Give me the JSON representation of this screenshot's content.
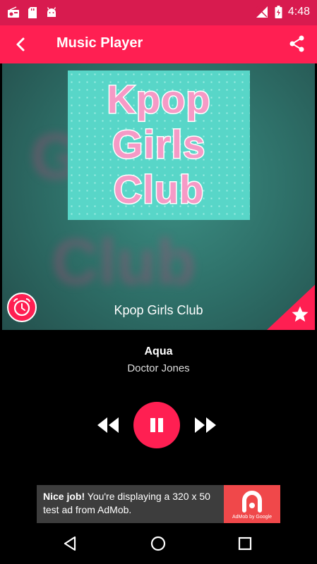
{
  "status_bar": {
    "time": "4:48",
    "icons": [
      "radio-icon",
      "sd-card-icon",
      "android-icon",
      "signal-icon",
      "battery-icon"
    ]
  },
  "app_bar": {
    "title": "Music Player",
    "back_icon": "back-arrow-icon",
    "share_icon": "share-icon"
  },
  "station": {
    "artwork_lines": [
      "Kpop",
      "Girls",
      "Club"
    ],
    "name": "Kpop Girls Club"
  },
  "now_playing": {
    "song": "Aqua",
    "artist": "Doctor Jones"
  },
  "ad": {
    "headline": "Nice job!",
    "body": " You're displaying a 320 x 50 test ad from AdMob.",
    "logo_caption": "AdMob by Google"
  },
  "colors": {
    "accent": "#ff1f52",
    "status_bar": "#d81b4f",
    "artwork_bg": "#58d6c8",
    "artwork_text": "#f59ac6"
  }
}
